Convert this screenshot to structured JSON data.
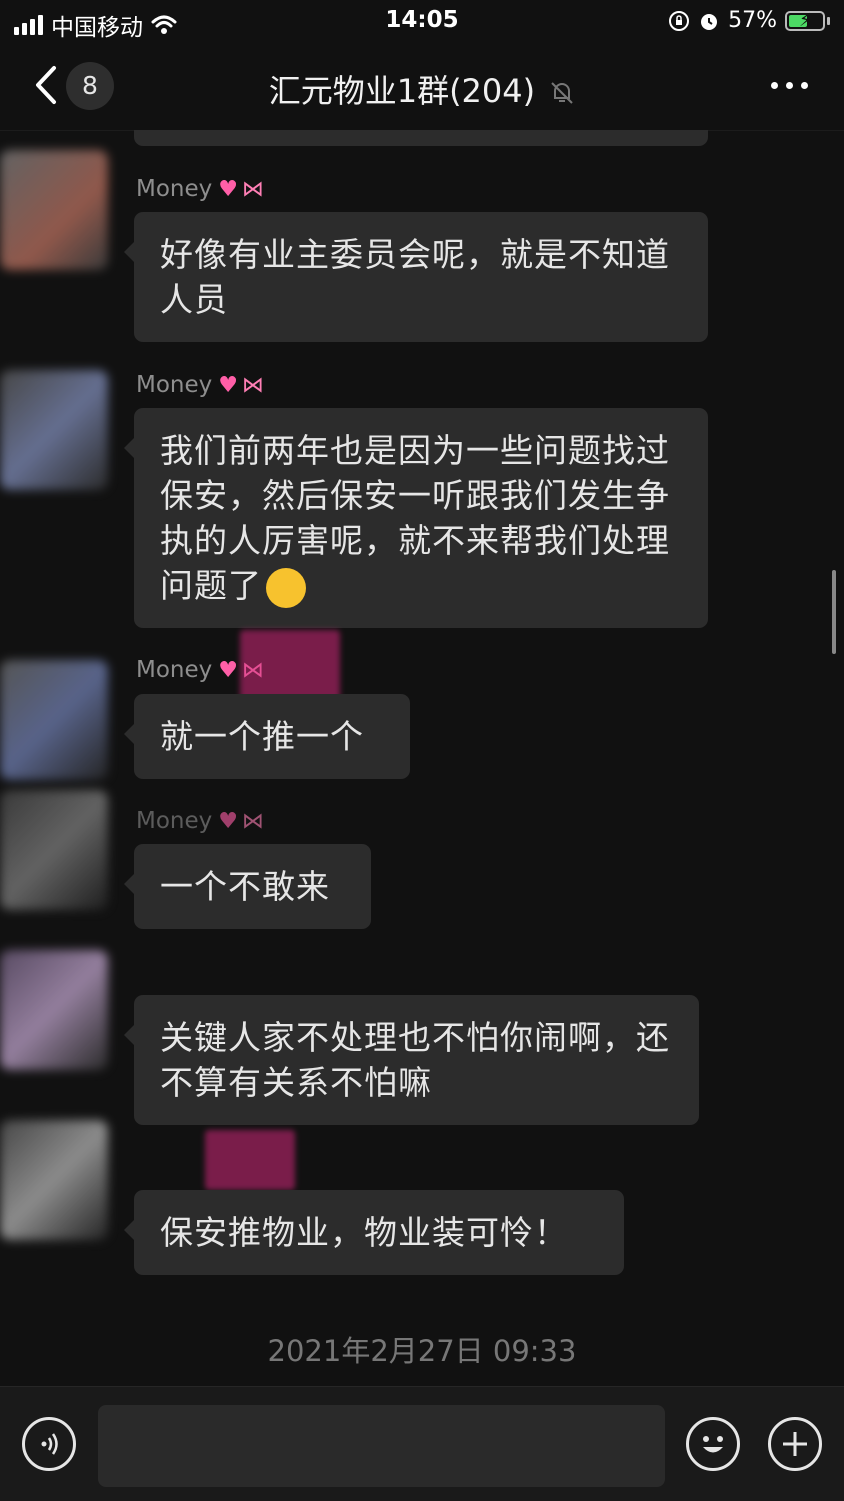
{
  "status_bar": {
    "carrier": "中国移动",
    "time": "14:05",
    "battery_percent": "57%",
    "battery_level": 0.57
  },
  "header": {
    "unread_count": "8",
    "title": "汇元物业1群(204)"
  },
  "messages": [
    {
      "sender": "Money",
      "text": "好像有业主委员会呢，就是不知道人员"
    },
    {
      "sender": "Money",
      "text": "我们前两年也是因为一些问题找过保安，然后保安一听跟我们发生争执的人厉害呢，就不来帮我们处理问题了"
    },
    {
      "sender": "Money",
      "text": "就一个推一个"
    },
    {
      "sender": "Money",
      "text": "一个不敢来"
    },
    {
      "sender": "",
      "text": "关键人家不处理也不怕你闹啊，还不算有关系不怕嘛"
    },
    {
      "sender": "",
      "text": "保安推物业，物业装可怜！"
    }
  ],
  "timestamp": "2021年2月27日 09:33",
  "icons": {
    "back": "chevron-left-icon",
    "mute": "bell-slash-icon",
    "more": "ellipsis-icon",
    "voice": "voice-icon",
    "emoji": "smiley-icon",
    "plus": "plus-icon"
  },
  "colors": {
    "background": "#111111",
    "bubble": "#2c2c2c",
    "battery_fill": "#4cd964"
  }
}
